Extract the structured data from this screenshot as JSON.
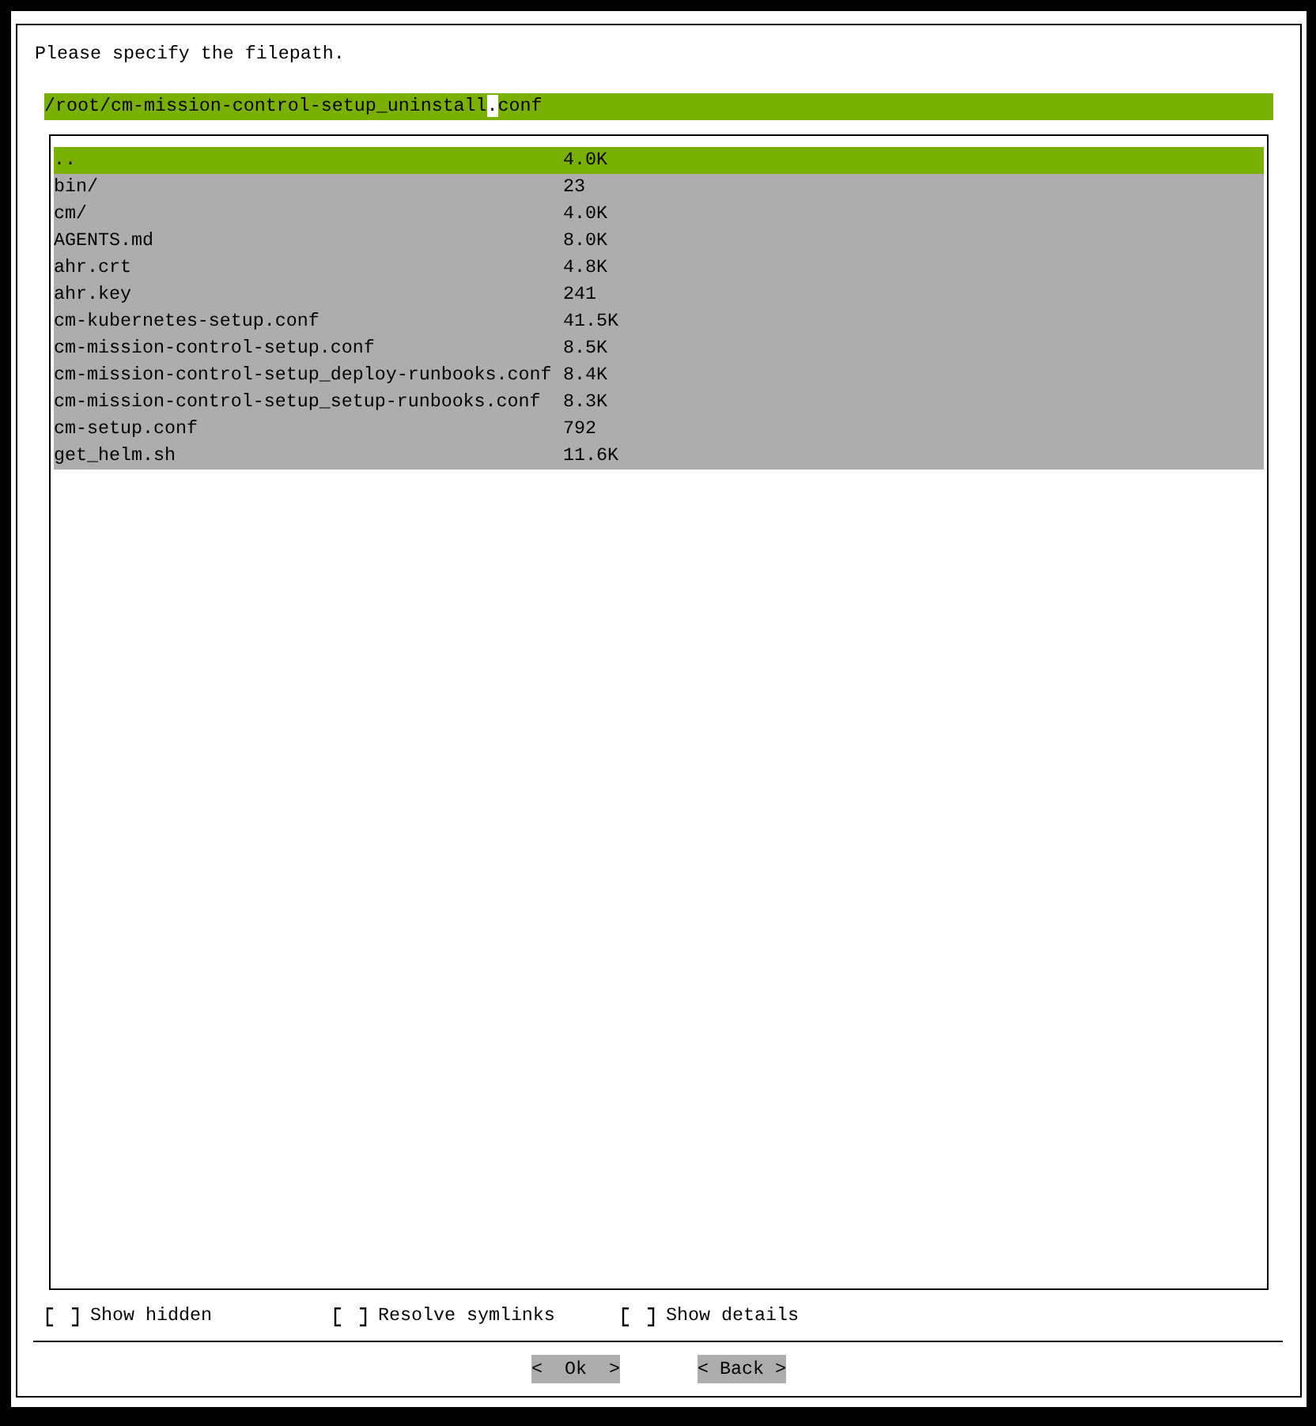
{
  "prompt": "Please specify the filepath.",
  "path_field": {
    "text_before_cursor": "/root/cm-mission-control-setup_uninstall",
    "cursor_char": ".",
    "text_after_cursor": "conf"
  },
  "files": [
    {
      "name": "..",
      "size": "4.0K",
      "selected": true
    },
    {
      "name": "bin/",
      "size": "23",
      "selected": false
    },
    {
      "name": "cm/",
      "size": "4.0K",
      "selected": false
    },
    {
      "name": "AGENTS.md",
      "size": "8.0K",
      "selected": false
    },
    {
      "name": "ahr.crt",
      "size": "4.8K",
      "selected": false
    },
    {
      "name": "ahr.key",
      "size": "241",
      "selected": false
    },
    {
      "name": "cm-kubernetes-setup.conf",
      "size": "41.5K",
      "selected": false
    },
    {
      "name": "cm-mission-control-setup.conf",
      "size": "8.5K",
      "selected": false
    },
    {
      "name": "cm-mission-control-setup_deploy-runbooks.conf",
      "size": "8.4K",
      "selected": false
    },
    {
      "name": "cm-mission-control-setup_setup-runbooks.conf",
      "size": "8.3K",
      "selected": false
    },
    {
      "name": "cm-setup.conf",
      "size": "792",
      "selected": false
    },
    {
      "name": "get_helm.sh",
      "size": "11.6K",
      "selected": false
    }
  ],
  "options": [
    {
      "label": "Show hidden",
      "checked": false
    },
    {
      "label": "Resolve symlinks",
      "checked": false
    },
    {
      "label": "Show details",
      "checked": false
    }
  ],
  "buttons": [
    {
      "label": "<  Ok  >"
    },
    {
      "label": "< Back >"
    }
  ]
}
